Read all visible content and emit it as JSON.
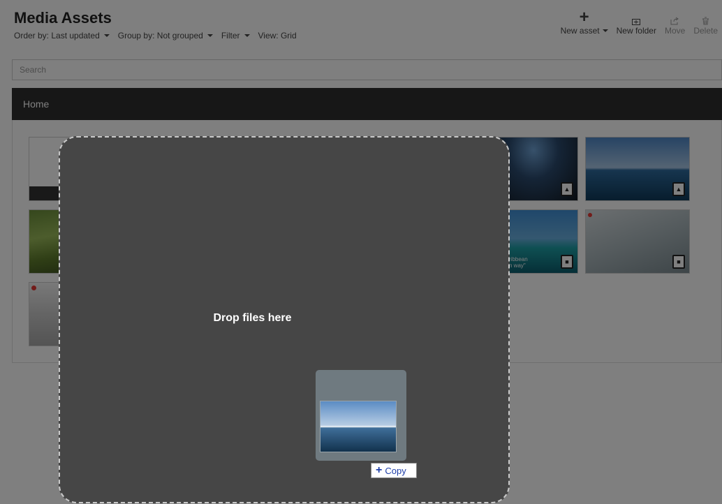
{
  "page": {
    "title": "Media Assets",
    "search_placeholder": "Search",
    "breadcrumb": "Home"
  },
  "options": {
    "order_by": "Order by: Last updated",
    "group_by": "Group by: Not grouped",
    "filter": "Filter",
    "view": "View: Grid"
  },
  "toolbar": {
    "new_asset": "New asset",
    "new_folder": "New folder",
    "move": "Move",
    "delete": "Delete"
  },
  "assets": {
    "beach_caption_1": "ribbean",
    "beach_caption_2": "n way\""
  },
  "overlay": {
    "drop_text": "Drop files here",
    "drag_effect": "Copy"
  }
}
